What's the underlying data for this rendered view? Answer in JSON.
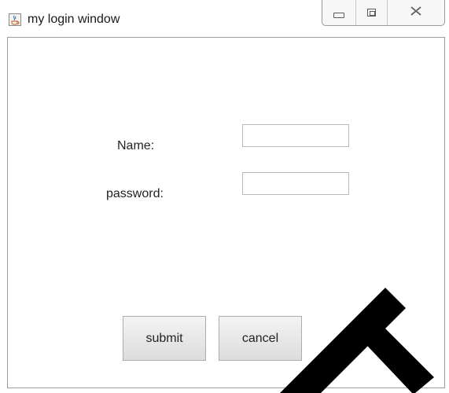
{
  "window": {
    "title": "my login window",
    "app_icon": "java-cup-icon",
    "controls": {
      "minimize_icon": "minimize-icon",
      "maximize_icon": "maximize-icon",
      "close_icon": "close-icon",
      "close_glyph": "☒"
    }
  },
  "form": {
    "name_label": "Name:",
    "name_value": "",
    "password_label": "password:",
    "password_value": ""
  },
  "buttons": {
    "submit_label": "submit",
    "cancel_label": "cancel"
  },
  "colors": {
    "window_border": "#9c9c9c",
    "button_face": "#e6e6e6",
    "overlay_mark": "#000000"
  }
}
